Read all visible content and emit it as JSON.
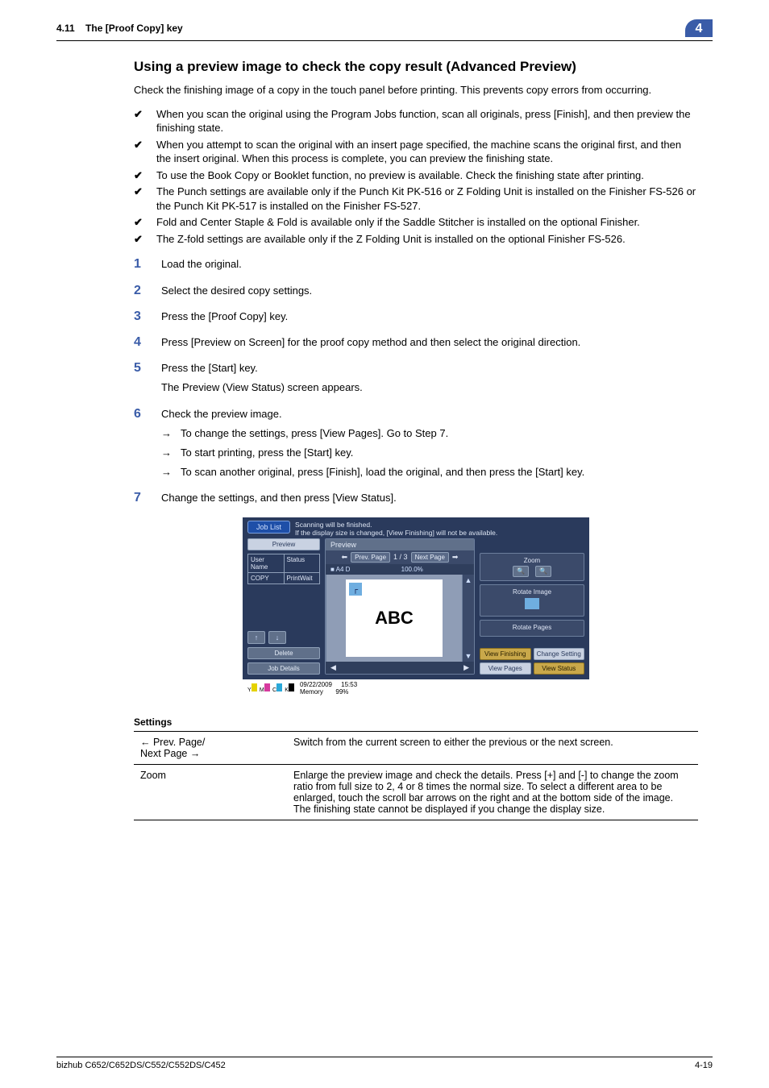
{
  "header": {
    "section": "4.11",
    "title": "The [Proof Copy] key",
    "chapter": "4"
  },
  "page_heading": "Using a preview image to check the copy result (Advanced Preview)",
  "intro": "Check the finishing image of a copy in the touch panel before printing. This prevents copy errors from occurring.",
  "prereq": [
    "When you scan the original using the Program Jobs function, scan all originals, press [Finish], and then preview the finishing state.",
    "When you attempt to scan the original with an insert page specified, the machine scans the original first, and then the insert original. When this process is complete, you can preview the finishing state.",
    "To use the Book Copy or Booklet function, no preview is available. Check the finishing state after printing.",
    "The Punch settings are available only if the Punch Kit PK-516 or Z Folding Unit is installed on the Finisher FS-526 or the Punch Kit PK-517 is installed on the Finisher FS-527.",
    "Fold and Center Staple & Fold is available only if the Saddle Stitcher is installed on the optional Finisher.",
    "The Z-fold settings are available only if the Z Folding Unit is installed on the optional Finisher FS-526."
  ],
  "steps": [
    {
      "n": "1",
      "text": "Load the original."
    },
    {
      "n": "2",
      "text": "Select the desired copy settings."
    },
    {
      "n": "3",
      "text": "Press the [Proof Copy] key."
    },
    {
      "n": "4",
      "text": "Press [Preview on Screen] for the proof copy method and then select the original direction."
    },
    {
      "n": "5",
      "text": "Press the [Start] key.",
      "sub_text": "The Preview (View Status) screen appears."
    },
    {
      "n": "6",
      "text": "Check the preview image.",
      "arrows": [
        "To change the settings, press [View Pages]. Go to Step 7.",
        "To start printing, press the [Start] key.",
        "To scan another original, press [Finish], load the original, and then press the [Start] key."
      ]
    },
    {
      "n": "7",
      "text": "Change the settings, and then press [View Status]."
    }
  ],
  "screenshot": {
    "job_list": "Job List",
    "msg1": "Scanning will be finished.",
    "msg2": "If the display size is changed, [View Finishing] will not be available.",
    "preview_btn": "Preview",
    "user_name": "User Name",
    "status": "Status",
    "copy": "COPY",
    "printwait": "PrintWait",
    "delete": "Delete",
    "job_details": "Job Details",
    "preview_title": "Preview",
    "prev_page": "Prev. Page",
    "page_ind": "1 /     3",
    "next_page": "Next Page",
    "paper": "A4",
    "orient": "D",
    "zoom_val": "100.0%",
    "page_text": "ABC",
    "zoom": "Zoom",
    "rotate_image": "Rotate Image",
    "rotate_pages": "Rotate Pages",
    "view_finishing": "View Finishing",
    "change_setting": "Change Setting",
    "view_pages": "View Pages",
    "view_status": "View Status",
    "date": "09/22/2009",
    "time": "15:53",
    "memory": "Memory",
    "mem_pct": "99%"
  },
  "settings_title": "Settings",
  "settings_rows": [
    {
      "name": "← Prev. Page/\nNext Page →",
      "desc": "Switch from the current screen to either the previous or the next screen."
    },
    {
      "name": "Zoom",
      "desc": "Enlarge the preview image and check the details. Press [+] and [-] to change the zoom ratio from full size to 2, 4 or 8 times the normal size. To select a different area to be enlarged, touch the scroll bar arrows on the right  and at the bottom side of the image.\nThe finishing state cannot be displayed if you change the display size."
    }
  ],
  "footer": {
    "left": "bizhub C652/C652DS/C552/C552DS/C452",
    "right": "4-19"
  }
}
